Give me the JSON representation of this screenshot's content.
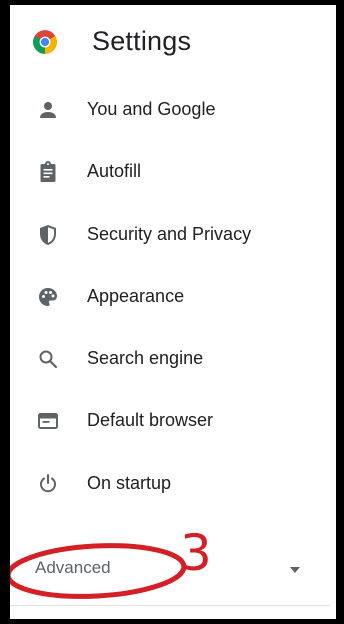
{
  "app": {
    "title": "Settings",
    "logo_icon": "chrome-logo-icon"
  },
  "menu": {
    "items": [
      {
        "label": "You and Google",
        "icon": "person-icon"
      },
      {
        "label": "Autofill",
        "icon": "clipboard-icon"
      },
      {
        "label": "Security and Privacy",
        "icon": "shield-icon"
      },
      {
        "label": "Appearance",
        "icon": "palette-icon"
      },
      {
        "label": "Search engine",
        "icon": "search-icon"
      },
      {
        "label": "Default browser",
        "icon": "browser-window-icon"
      },
      {
        "label": "On startup",
        "icon": "power-icon"
      }
    ]
  },
  "advanced": {
    "label": "Advanced",
    "icon": "caret-down-icon"
  },
  "annotation": {
    "number": "3",
    "color": "#d32027"
  },
  "colors": {
    "text_primary": "#202124",
    "text_secondary": "#5f6368",
    "icon": "#5f6368",
    "frame": "#000000"
  }
}
